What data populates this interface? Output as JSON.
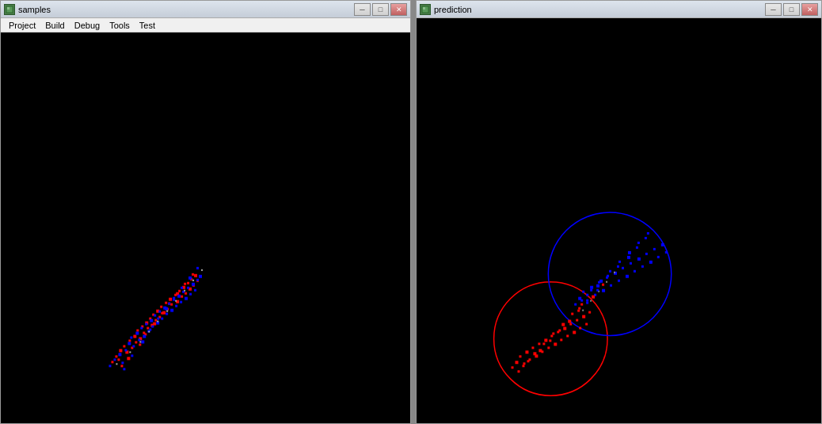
{
  "windows": [
    {
      "id": "samples",
      "title": "samples",
      "menuItems": [
        "Project",
        "Build",
        "Debug",
        "Tools",
        "Test"
      ],
      "scatter": {
        "points": "diagonal_cluster",
        "colors": [
          "red",
          "blue",
          "gray"
        ],
        "centerX": 185,
        "centerY": 370,
        "spread": 120,
        "angle": -45
      }
    },
    {
      "id": "prediction",
      "title": "prediction",
      "menuItems": [],
      "scatter": {
        "points": "two_clusters_with_circles",
        "redCircleCenter": [
          680,
          410
        ],
        "redCircleRadius": 70,
        "blueCircleCenter": [
          745,
          330
        ],
        "blueCircleRadius": 75
      }
    }
  ],
  "titlebar": {
    "minimize_label": "─",
    "maximize_label": "□",
    "close_label": "✕"
  }
}
